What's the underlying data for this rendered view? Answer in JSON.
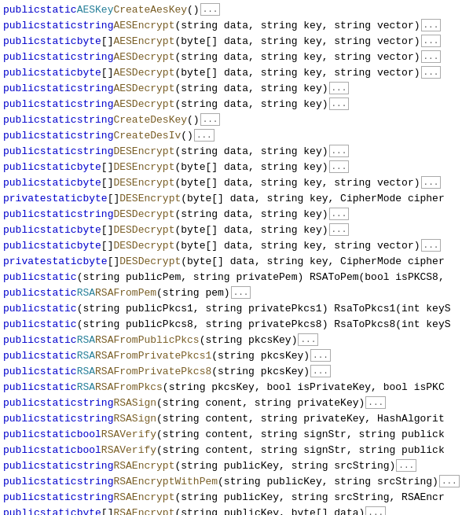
{
  "lines": [
    {
      "id": 1,
      "parts": [
        {
          "t": "public",
          "c": "kw-public"
        },
        {
          "t": " "
        },
        {
          "t": "static",
          "c": "kw-static"
        },
        {
          "t": " "
        },
        {
          "t": "AESKey",
          "c": "type-name"
        },
        {
          "t": " "
        },
        {
          "t": "CreateAesKey",
          "c": "method-name"
        },
        {
          "t": "()"
        },
        {
          "t": "...",
          "c": "ellipsis"
        }
      ]
    },
    {
      "id": 2,
      "parts": [
        {
          "t": "public",
          "c": "kw-public"
        },
        {
          "t": " "
        },
        {
          "t": "static",
          "c": "kw-static"
        },
        {
          "t": " "
        },
        {
          "t": "string",
          "c": "kw-string"
        },
        {
          "t": " "
        },
        {
          "t": "AESEncrypt",
          "c": "method-name"
        },
        {
          "t": "(string data, string key, string vector)"
        },
        {
          "t": "...",
          "c": "ellipsis"
        }
      ]
    },
    {
      "id": 3,
      "parts": [
        {
          "t": "public",
          "c": "kw-public"
        },
        {
          "t": " "
        },
        {
          "t": "static",
          "c": "kw-static"
        },
        {
          "t": " "
        },
        {
          "t": "byte",
          "c": "kw-byte"
        },
        {
          "t": "[] "
        },
        {
          "t": "AESEncrypt",
          "c": "method-name"
        },
        {
          "t": "(byte[] data, string key, string vector)"
        },
        {
          "t": "...",
          "c": "ellipsis"
        }
      ]
    },
    {
      "id": 4,
      "parts": [
        {
          "t": "public",
          "c": "kw-public"
        },
        {
          "t": " "
        },
        {
          "t": "static",
          "c": "kw-static"
        },
        {
          "t": " "
        },
        {
          "t": "string",
          "c": "kw-string"
        },
        {
          "t": " "
        },
        {
          "t": "AESDecrypt",
          "c": "method-name"
        },
        {
          "t": "(string data, string key, string vector)"
        },
        {
          "t": "...",
          "c": "ellipsis"
        }
      ]
    },
    {
      "id": 5,
      "parts": [
        {
          "t": "public",
          "c": "kw-public"
        },
        {
          "t": " "
        },
        {
          "t": "static",
          "c": "kw-static"
        },
        {
          "t": " "
        },
        {
          "t": "byte",
          "c": "kw-byte"
        },
        {
          "t": "[] "
        },
        {
          "t": "AESDecrypt",
          "c": "method-name"
        },
        {
          "t": "(byte[] data, string key, string vector)"
        },
        {
          "t": "...",
          "c": "ellipsis"
        }
      ]
    },
    {
      "id": 6,
      "parts": [
        {
          "t": "public",
          "c": "kw-public"
        },
        {
          "t": " "
        },
        {
          "t": "static",
          "c": "kw-static"
        },
        {
          "t": " "
        },
        {
          "t": "string",
          "c": "kw-string"
        },
        {
          "t": " "
        },
        {
          "t": "AESDecrypt",
          "c": "method-name"
        },
        {
          "t": "(string data, string key)"
        },
        {
          "t": "...",
          "c": "ellipsis"
        }
      ]
    },
    {
      "id": 7,
      "parts": [
        {
          "t": "public",
          "c": "kw-public"
        },
        {
          "t": " "
        },
        {
          "t": "static",
          "c": "kw-static"
        },
        {
          "t": " "
        },
        {
          "t": "string",
          "c": "kw-string"
        },
        {
          "t": " "
        },
        {
          "t": "AESDecrypt",
          "c": "method-name"
        },
        {
          "t": "(string data, string key)"
        },
        {
          "t": "...",
          "c": "ellipsis"
        }
      ]
    },
    {
      "id": 8,
      "parts": [
        {
          "t": "public",
          "c": "kw-public"
        },
        {
          "t": " "
        },
        {
          "t": "static",
          "c": "kw-static"
        },
        {
          "t": " "
        },
        {
          "t": "string",
          "c": "kw-string"
        },
        {
          "t": " "
        },
        {
          "t": "CreateDesKey",
          "c": "method-name"
        },
        {
          "t": "()"
        },
        {
          "t": "...",
          "c": "ellipsis"
        }
      ]
    },
    {
      "id": 9,
      "parts": [
        {
          "t": "public",
          "c": "kw-public"
        },
        {
          "t": " "
        },
        {
          "t": "static",
          "c": "kw-static"
        },
        {
          "t": " "
        },
        {
          "t": "string",
          "c": "kw-string"
        },
        {
          "t": " "
        },
        {
          "t": "CreateDesIv",
          "c": "method-name"
        },
        {
          "t": "()"
        },
        {
          "t": "...",
          "c": "ellipsis"
        }
      ]
    },
    {
      "id": 10,
      "parts": [
        {
          "t": "public",
          "c": "kw-public"
        },
        {
          "t": " "
        },
        {
          "t": "static",
          "c": "kw-static"
        },
        {
          "t": " "
        },
        {
          "t": "string",
          "c": "kw-string"
        },
        {
          "t": " "
        },
        {
          "t": "DESEncrypt",
          "c": "method-name"
        },
        {
          "t": "(string data, string key)"
        },
        {
          "t": "...",
          "c": "ellipsis"
        }
      ]
    },
    {
      "id": 11,
      "parts": [
        {
          "t": "public",
          "c": "kw-public"
        },
        {
          "t": " "
        },
        {
          "t": "static",
          "c": "kw-static"
        },
        {
          "t": " "
        },
        {
          "t": "byte",
          "c": "kw-byte"
        },
        {
          "t": "[] "
        },
        {
          "t": "DESEncrypt",
          "c": "method-name"
        },
        {
          "t": "(byte[] data, string key)"
        },
        {
          "t": "...",
          "c": "ellipsis"
        }
      ]
    },
    {
      "id": 12,
      "parts": [
        {
          "t": "public",
          "c": "kw-public"
        },
        {
          "t": " "
        },
        {
          "t": "static",
          "c": "kw-static"
        },
        {
          "t": " "
        },
        {
          "t": "byte",
          "c": "kw-byte"
        },
        {
          "t": "[] "
        },
        {
          "t": "DESEncrypt",
          "c": "method-name"
        },
        {
          "t": "(byte[] data, string key, string vector)"
        },
        {
          "t": "...",
          "c": "ellipsis"
        }
      ]
    },
    {
      "id": 13,
      "parts": [
        {
          "t": "private",
          "c": "kw-private"
        },
        {
          "t": " "
        },
        {
          "t": "static",
          "c": "kw-static"
        },
        {
          "t": " "
        },
        {
          "t": "byte",
          "c": "kw-byte"
        },
        {
          "t": "[] "
        },
        {
          "t": "DESEncrypt",
          "c": "method-name"
        },
        {
          "t": "(byte[] data, string key, CipherMode cipher"
        }
      ]
    },
    {
      "id": 14,
      "parts": [
        {
          "t": "public",
          "c": "kw-public"
        },
        {
          "t": " "
        },
        {
          "t": "static",
          "c": "kw-static"
        },
        {
          "t": " "
        },
        {
          "t": "string",
          "c": "kw-string"
        },
        {
          "t": " "
        },
        {
          "t": "DESDecrypt",
          "c": "method-name"
        },
        {
          "t": "(string data, string key)"
        },
        {
          "t": "...",
          "c": "ellipsis"
        }
      ]
    },
    {
      "id": 15,
      "parts": [
        {
          "t": "public",
          "c": "kw-public"
        },
        {
          "t": " "
        },
        {
          "t": "static",
          "c": "kw-static"
        },
        {
          "t": " "
        },
        {
          "t": "byte",
          "c": "kw-byte"
        },
        {
          "t": "[] "
        },
        {
          "t": "DESDecrypt",
          "c": "method-name"
        },
        {
          "t": "(byte[] data, string key)"
        },
        {
          "t": "...",
          "c": "ellipsis"
        }
      ]
    },
    {
      "id": 16,
      "parts": [
        {
          "t": "public",
          "c": "kw-public"
        },
        {
          "t": " "
        },
        {
          "t": "static",
          "c": "kw-static"
        },
        {
          "t": " "
        },
        {
          "t": "byte",
          "c": "kw-byte"
        },
        {
          "t": "[] "
        },
        {
          "t": "DESDecrypt",
          "c": "method-name"
        },
        {
          "t": "(byte[] data, string key, string vector)"
        },
        {
          "t": "...",
          "c": "ellipsis"
        }
      ]
    },
    {
      "id": 17,
      "parts": [
        {
          "t": "private",
          "c": "kw-private"
        },
        {
          "t": " "
        },
        {
          "t": "static",
          "c": "kw-static"
        },
        {
          "t": " "
        },
        {
          "t": "byte",
          "c": "kw-byte"
        },
        {
          "t": "[] "
        },
        {
          "t": "DESDecrypt",
          "c": "method-name"
        },
        {
          "t": "(byte[] data, string key, CipherMode cipher"
        }
      ]
    },
    {
      "id": 18,
      "parts": [
        {
          "t": "public",
          "c": "kw-public"
        },
        {
          "t": " "
        },
        {
          "t": "static",
          "c": "kw-static"
        },
        {
          "t": " "
        },
        {
          "t": "(string publicPem, string privatePem) RSAToPem(bool isPKCS8,"
        }
      ]
    },
    {
      "id": 19,
      "parts": [
        {
          "t": "public",
          "c": "kw-public"
        },
        {
          "t": " "
        },
        {
          "t": "static",
          "c": "kw-static"
        },
        {
          "t": " "
        },
        {
          "t": "RSA",
          "c": "type-name"
        },
        {
          "t": " "
        },
        {
          "t": "RSAFromPem",
          "c": "method-name"
        },
        {
          "t": "(string pem)"
        },
        {
          "t": "...",
          "c": "ellipsis"
        }
      ]
    },
    {
      "id": 20,
      "parts": [
        {
          "t": "public",
          "c": "kw-public"
        },
        {
          "t": " "
        },
        {
          "t": "static",
          "c": "kw-static"
        },
        {
          "t": " "
        },
        {
          "t": "(string publicPkcs1, string privatePkcs1) RsaToPkcs1(int keyS"
        }
      ]
    },
    {
      "id": 21,
      "parts": [
        {
          "t": "public",
          "c": "kw-public"
        },
        {
          "t": " "
        },
        {
          "t": "static",
          "c": "kw-static"
        },
        {
          "t": " "
        },
        {
          "t": "(string publicPkcs8, string privatePkcs8) RsaToPkcs8(int keyS"
        }
      ]
    },
    {
      "id": 22,
      "parts": [
        {
          "t": "public",
          "c": "kw-public"
        },
        {
          "t": " "
        },
        {
          "t": "static",
          "c": "kw-static"
        },
        {
          "t": " "
        },
        {
          "t": "RSA",
          "c": "type-name"
        },
        {
          "t": " "
        },
        {
          "t": "RSAFromPublicPkcs",
          "c": "method-name"
        },
        {
          "t": "(string pkcsKey)"
        },
        {
          "t": "...",
          "c": "ellipsis"
        }
      ]
    },
    {
      "id": 23,
      "parts": [
        {
          "t": "public",
          "c": "kw-public"
        },
        {
          "t": " "
        },
        {
          "t": "static",
          "c": "kw-static"
        },
        {
          "t": " "
        },
        {
          "t": "RSA",
          "c": "type-name"
        },
        {
          "t": " "
        },
        {
          "t": "RSAFromPrivatePkcs1",
          "c": "method-name"
        },
        {
          "t": "(string pkcsKey)"
        },
        {
          "t": "...",
          "c": "ellipsis"
        }
      ]
    },
    {
      "id": 24,
      "parts": [
        {
          "t": "public",
          "c": "kw-public"
        },
        {
          "t": " "
        },
        {
          "t": "static",
          "c": "kw-static"
        },
        {
          "t": " "
        },
        {
          "t": "RSA",
          "c": "type-name"
        },
        {
          "t": " "
        },
        {
          "t": "RSAFromPrivatePkcs8",
          "c": "method-name"
        },
        {
          "t": "(string pkcsKey)"
        },
        {
          "t": "...",
          "c": "ellipsis"
        }
      ]
    },
    {
      "id": 25,
      "parts": [
        {
          "t": "public",
          "c": "kw-public"
        },
        {
          "t": " "
        },
        {
          "t": "static",
          "c": "kw-static"
        },
        {
          "t": " "
        },
        {
          "t": "RSA",
          "c": "type-name"
        },
        {
          "t": " "
        },
        {
          "t": "RSAFromPkcs",
          "c": "method-name"
        },
        {
          "t": "(string pkcsKey, bool isPrivateKey, bool isPKC"
        }
      ]
    },
    {
      "id": 26,
      "parts": [
        {
          "t": "public",
          "c": "kw-public"
        },
        {
          "t": " "
        },
        {
          "t": "static",
          "c": "kw-static"
        },
        {
          "t": " "
        },
        {
          "t": "string",
          "c": "kw-string"
        },
        {
          "t": " "
        },
        {
          "t": "RSASign",
          "c": "method-name"
        },
        {
          "t": "(string conent, string privateKey)"
        },
        {
          "t": "...",
          "c": "ellipsis"
        }
      ]
    },
    {
      "id": 27,
      "parts": [
        {
          "t": "public",
          "c": "kw-public"
        },
        {
          "t": " "
        },
        {
          "t": "static",
          "c": "kw-static"
        },
        {
          "t": " "
        },
        {
          "t": "string",
          "c": "kw-string"
        },
        {
          "t": " "
        },
        {
          "t": "RSASign",
          "c": "method-name"
        },
        {
          "t": "(string content, string privateKey, HashAlgorit"
        }
      ]
    },
    {
      "id": 28,
      "parts": [
        {
          "t": "public",
          "c": "kw-public"
        },
        {
          "t": " "
        },
        {
          "t": "static",
          "c": "kw-static"
        },
        {
          "t": " "
        },
        {
          "t": "bool",
          "c": "kw-bool"
        },
        {
          "t": " "
        },
        {
          "t": "RSAVerify",
          "c": "method-name"
        },
        {
          "t": "(string content, string signStr, string publick"
        }
      ]
    },
    {
      "id": 29,
      "parts": [
        {
          "t": "public",
          "c": "kw-public"
        },
        {
          "t": " "
        },
        {
          "t": "static",
          "c": "kw-static"
        },
        {
          "t": " "
        },
        {
          "t": "bool",
          "c": "kw-bool"
        },
        {
          "t": " "
        },
        {
          "t": "RSAVerify",
          "c": "method-name"
        },
        {
          "t": "(string content, string signStr, string publick"
        }
      ]
    },
    {
      "id": 30,
      "parts": [
        {
          "t": "public",
          "c": "kw-public"
        },
        {
          "t": " "
        },
        {
          "t": "static",
          "c": "kw-static"
        },
        {
          "t": " "
        },
        {
          "t": "string",
          "c": "kw-string"
        },
        {
          "t": " "
        },
        {
          "t": "RSAEncrypt",
          "c": "method-name"
        },
        {
          "t": "(string publicKey, string srcString)"
        },
        {
          "t": "...",
          "c": "ellipsis"
        }
      ]
    },
    {
      "id": 31,
      "parts": [
        {
          "t": "public",
          "c": "kw-public"
        },
        {
          "t": " "
        },
        {
          "t": "static",
          "c": "kw-static"
        },
        {
          "t": " "
        },
        {
          "t": "string",
          "c": "kw-string"
        },
        {
          "t": " "
        },
        {
          "t": "RSAEncryptWithPem",
          "c": "method-name"
        },
        {
          "t": "(string publicKey, string srcString)"
        },
        {
          "t": "...",
          "c": "ellipsis"
        }
      ]
    },
    {
      "id": 32,
      "parts": [
        {
          "t": "public",
          "c": "kw-public"
        },
        {
          "t": " "
        },
        {
          "t": "static",
          "c": "kw-static"
        },
        {
          "t": " "
        },
        {
          "t": "string",
          "c": "kw-string"
        },
        {
          "t": " "
        },
        {
          "t": "RSAEncrypt",
          "c": "method-name"
        },
        {
          "t": "(string publicKey, string srcString, RSAEncr"
        }
      ]
    },
    {
      "id": 33,
      "parts": [
        {
          "t": "public",
          "c": "kw-public"
        },
        {
          "t": " "
        },
        {
          "t": "static",
          "c": "kw-static"
        },
        {
          "t": " "
        },
        {
          "t": "byte",
          "c": "kw-byte"
        },
        {
          "t": "[] "
        },
        {
          "t": "RSAEncrypt",
          "c": "method-name"
        },
        {
          "t": "(string publicKey, byte[] data)"
        },
        {
          "t": "...",
          "c": "ellipsis"
        }
      ]
    }
  ]
}
